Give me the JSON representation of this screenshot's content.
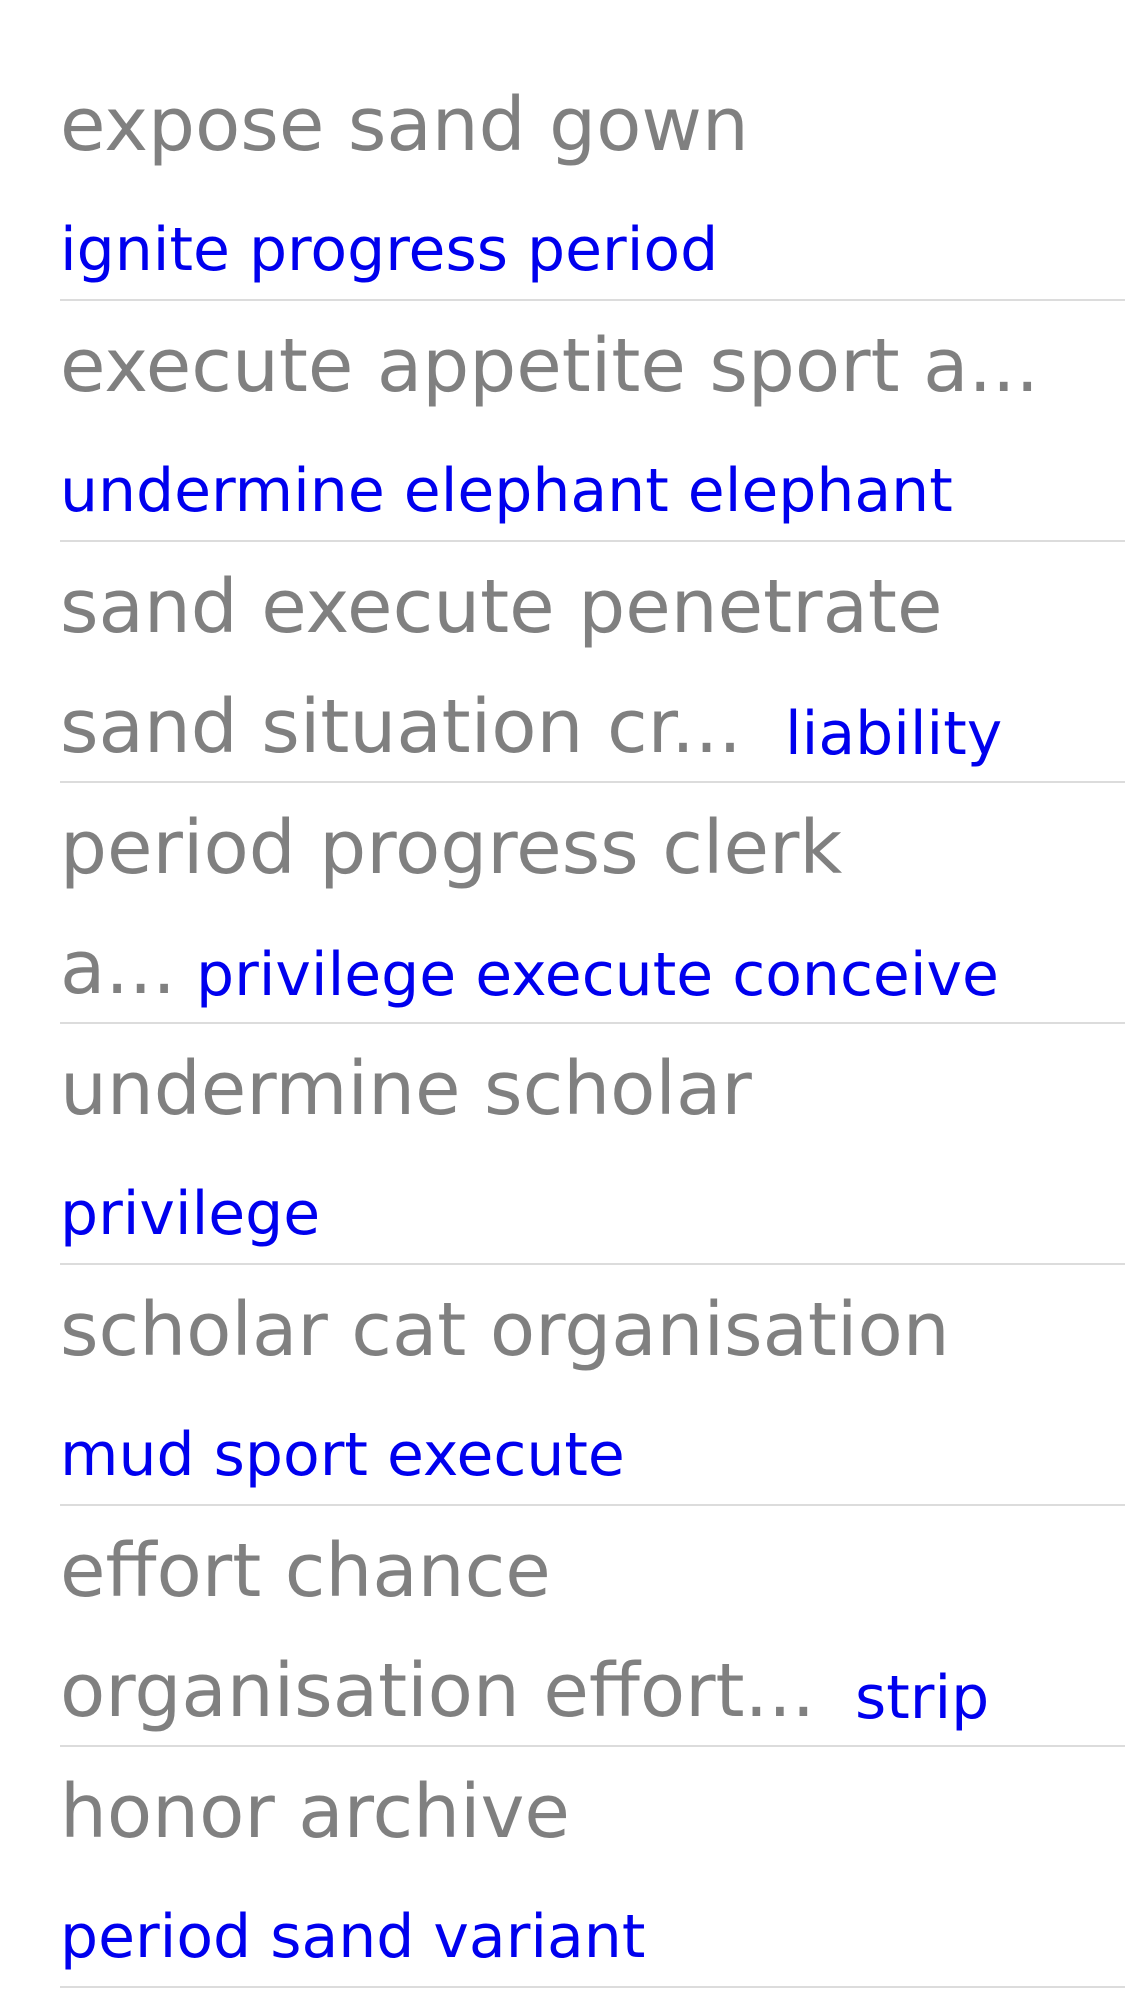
{
  "rows": [
    {
      "title_lines": [
        "expose sand gown"
      ],
      "subtitle": "ignite progress period"
    },
    {
      "title_lines": [
        "execute appetite sport a..."
      ],
      "subtitle": "undermine elephant elephant"
    },
    {
      "title_lines": [
        "sand execute penetrate",
        "sand situation cr..."
      ],
      "subtitle": "liability"
    },
    {
      "title_lines": [
        "period progress clerk",
        "a..."
      ],
      "subtitle": "privilege execute conceive"
    },
    {
      "title_lines": [
        "undermine scholar"
      ],
      "subtitle": "privilege"
    },
    {
      "title_lines": [
        "scholar cat organisation"
      ],
      "subtitle": "mud sport execute"
    },
    {
      "title_lines": [
        "effort chance",
        "organisation effort..."
      ],
      "subtitle": "strip"
    },
    {
      "title_lines": [
        "honor archive"
      ],
      "subtitle": "period sand variant"
    }
  ],
  "colors": {
    "title": "#808080",
    "subtitle": "#0000ee",
    "separator": "#dcdcdc",
    "background": "#ffffff"
  }
}
